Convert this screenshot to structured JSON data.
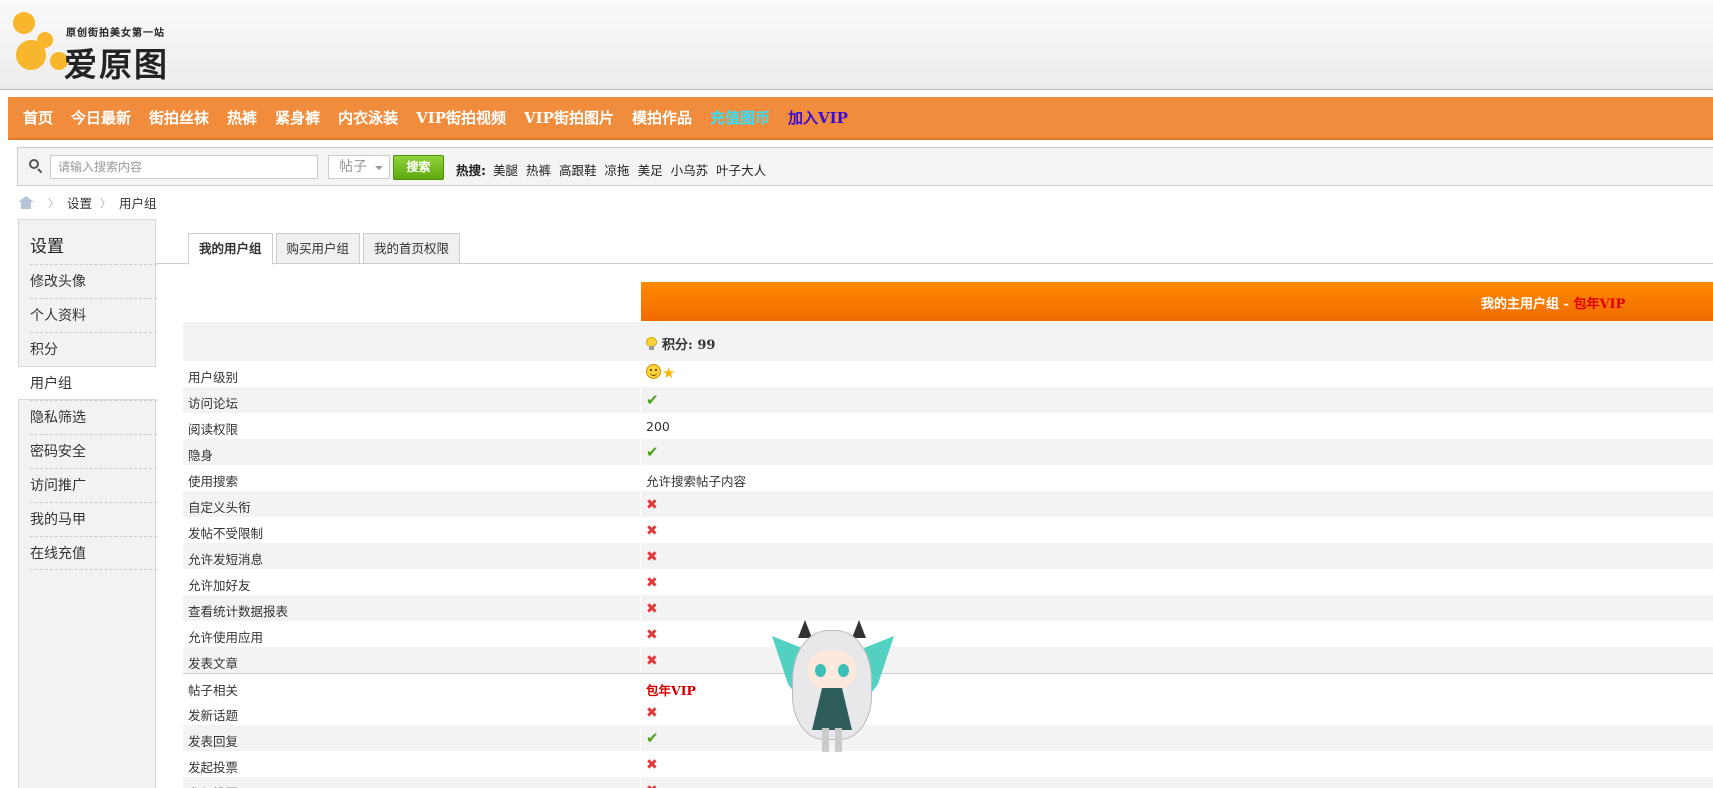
{
  "logo": {
    "tagline": "原创街拍美女第一站",
    "name": "爱原图"
  },
  "nav": {
    "items": [
      {
        "label": "首页"
      },
      {
        "label": "今日最新"
      },
      {
        "label": "街拍丝袜"
      },
      {
        "label": "热裤"
      },
      {
        "label": "紧身裤"
      },
      {
        "label": "内衣泳装"
      },
      {
        "label": "VIP街拍视频"
      },
      {
        "label": "VIP街拍图片"
      },
      {
        "label": "模拍作品"
      },
      {
        "label": "充值图币"
      },
      {
        "label": "加入VIP"
      }
    ]
  },
  "search": {
    "placeholder": "请输入搜索内容",
    "type_selected": "帖子",
    "button_label": "搜索",
    "hot_label": "热搜:",
    "hot_keywords": [
      "美腿",
      "热裤",
      "高跟鞋",
      "凉拖",
      "美足",
      "小乌苏",
      "叶子大人"
    ]
  },
  "breadcrumb": {
    "items": [
      "设置",
      "用户组"
    ]
  },
  "sidebar": {
    "title": "设置",
    "items": [
      "修改头像",
      "个人资料",
      "积分",
      "用户组",
      "隐私筛选",
      "密码安全",
      "访问推广",
      "我的马甲",
      "在线充值"
    ],
    "active": "用户组"
  },
  "tabs": [
    "我的用户组",
    "购买用户组",
    "我的首页权限"
  ],
  "group": {
    "header_label": "我的主用户组",
    "header_sep": " - ",
    "group_name": "包年VIP",
    "score_label": "积分: 99"
  },
  "rows": [
    {
      "label": "用户级别",
      "value_type": "level-icons"
    },
    {
      "label": "访问论坛",
      "value_type": "check"
    },
    {
      "label": "阅读权限",
      "value": "200"
    },
    {
      "label": "隐身",
      "value_type": "check"
    },
    {
      "label": "使用搜索",
      "value": "允许搜索帖子内容"
    },
    {
      "label": "自定义头衔",
      "value_type": "cross"
    },
    {
      "label": "发帖不受限制",
      "value_type": "cross"
    },
    {
      "label": "允许发短消息",
      "value_type": "cross"
    },
    {
      "label": "允许加好友",
      "value_type": "cross"
    },
    {
      "label": "查看统计数据报表",
      "value_type": "cross"
    },
    {
      "label": "允许使用应用",
      "value_type": "cross"
    },
    {
      "label": "发表文章",
      "value_type": "cross"
    }
  ],
  "section_row": {
    "label": "帖子相关",
    "value": "包年VIP"
  },
  "post_rows": [
    {
      "label": "发新话题",
      "value_type": "cross"
    },
    {
      "label": "发表回复",
      "value_type": "check"
    },
    {
      "label": "发起投票",
      "value_type": "cross"
    },
    {
      "label": "参与投票",
      "value_type": "cross"
    }
  ],
  "glyphs": {
    "check": "✔",
    "cross": "✖",
    "star": "★"
  },
  "colors": {
    "nav_bg": "#f08c3c",
    "vip_red": "#e00000",
    "check_green": "#4aa318",
    "cross_red": "#e23a3a"
  }
}
